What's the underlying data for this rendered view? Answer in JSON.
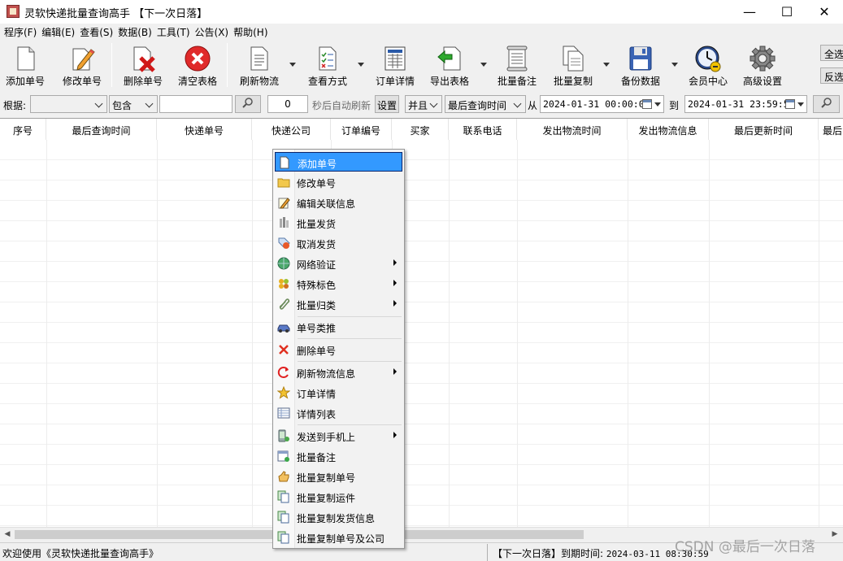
{
  "window": {
    "title": "灵软快递批量查询高手 【下一次日落】",
    "min_glyph": "—",
    "max_glyph": "☐",
    "close_glyph": "✕"
  },
  "menu": [
    "程序(F)",
    "编辑(E)",
    "查看(S)",
    "数据(B)",
    "工具(T)",
    "公告(X)",
    "帮助(H)"
  ],
  "toolbar": {
    "add": "添加单号",
    "edit": "修改单号",
    "delete": "删除单号",
    "clear": "清空表格",
    "refresh": "刷新物流",
    "view_mode": "查看方式",
    "order_detail": "订单详情",
    "export": "导出表格",
    "batch_note": "批量备注",
    "batch_copy": "批量复制",
    "backup": "备份数据",
    "member": "会员中心",
    "advanced": "高级设置",
    "select_all": "全选",
    "invert": "反选"
  },
  "filter": {
    "basis_label": "根据:",
    "field_value": "",
    "match_value": "包含",
    "search_text": "",
    "interval": "0",
    "auto_refresh_label": "秒后自动刷新",
    "settings_button": "设置",
    "logic_value": "并且",
    "time_field_value": "最后查询时间",
    "from_label": "从",
    "from_datetime": "2024-01-31 00:00:00",
    "to_label": "到",
    "to_datetime": "2024-01-31 23:59:59"
  },
  "columns": [
    "序号",
    "最后查询时间",
    "快递单号",
    "快递公司",
    "订单编号",
    "买家",
    "联系电话",
    "发出物流时间",
    "发出物流信息",
    "最后更新时间",
    "最后"
  ],
  "context_menu": {
    "items": [
      {
        "label": "添加单号",
        "icon": "document-icon",
        "submenu": false,
        "selected": true
      },
      {
        "label": "修改单号",
        "icon": "folder-icon",
        "submenu": false
      },
      {
        "label": "编辑关联信息",
        "icon": "note-edit-icon",
        "submenu": false
      },
      {
        "label": "批量发货",
        "icon": "ship-icon",
        "submenu": false
      },
      {
        "label": "取消发货",
        "icon": "tag-icon",
        "submenu": false
      },
      {
        "label": "网络验证",
        "icon": "globe-icon",
        "submenu": true
      },
      {
        "label": "特殊标色",
        "icon": "palette-icon",
        "submenu": true
      },
      {
        "label": "批量归类",
        "icon": "paperclip-icon",
        "submenu": true
      },
      {
        "label": "单号类推",
        "icon": "car-icon",
        "submenu": false
      },
      {
        "label": "删除单号",
        "icon": "red-x-icon",
        "submenu": false
      },
      {
        "label": "刷新物流信息",
        "icon": "refresh-icon",
        "submenu": true
      },
      {
        "label": "订单详情",
        "icon": "star-icon",
        "submenu": false
      },
      {
        "label": "详情列表",
        "icon": "list-icon",
        "submenu": false
      },
      {
        "label": "发送到手机上",
        "icon": "phone-icon",
        "submenu": true
      },
      {
        "label": "批量备注",
        "icon": "note-add-icon",
        "submenu": false
      },
      {
        "label": "批量复制单号",
        "icon": "hand-icon",
        "submenu": false
      },
      {
        "label": "批量复制运件",
        "icon": "copy-icon",
        "submenu": false
      },
      {
        "label": "批量复制发货信息",
        "icon": "copy-icon",
        "submenu": false
      },
      {
        "label": "批量复制单号及公司",
        "icon": "copy-icon",
        "submenu": false
      }
    ]
  },
  "status": {
    "welcome": "欢迎使用《灵软快递批量查询高手》",
    "owner": "【下一次日落】",
    "expiry_label": "到期时间:",
    "expiry_date": "2024-03-11 08:30:59"
  },
  "scrollbar": {
    "left_glyph": "◀",
    "right_glyph": "▶"
  },
  "watermark": "CSDN @最后一次日落",
  "colors": {
    "selection": "#3399ff",
    "accent_blue": "#1f5fb8"
  }
}
